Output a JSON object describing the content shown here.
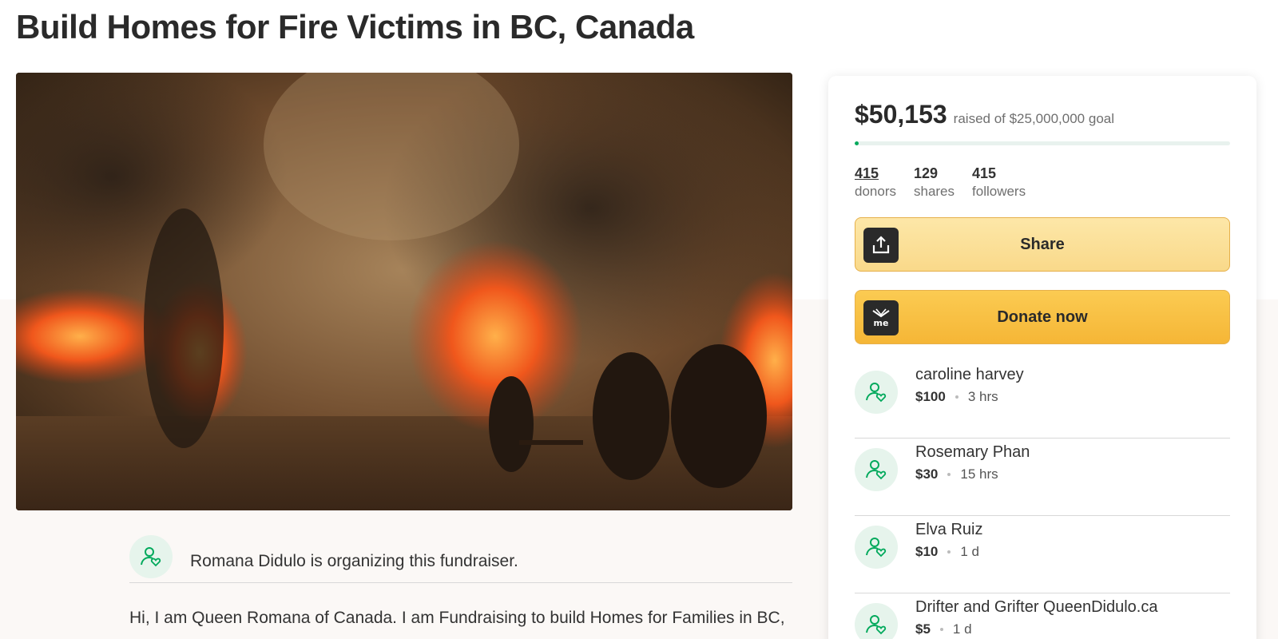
{
  "page": {
    "title": "Build Homes for Fire Victims in BC, Canada"
  },
  "organizer": {
    "text": "Romana Didulo is organizing this fundraiser.",
    "icon": "user-heart-icon"
  },
  "story": {
    "first_line": "Hi, I am Queen Romana of Canada. I am Fundraising to build Homes for Families in BC,"
  },
  "sidebar": {
    "amount_raised": "$50,153",
    "goal_text": "raised of $25,000,000 goal",
    "progress_fraction": 0.002,
    "stats": [
      {
        "value": "415",
        "label": "donors"
      },
      {
        "value": "129",
        "label": "shares"
      },
      {
        "value": "415",
        "label": "followers"
      }
    ],
    "share_label": "Share",
    "share_icon": "upload-share-icon",
    "donate_label": "Donate now",
    "donate_icon": "gofundme-logo-icon",
    "donations": [
      {
        "name": "caroline harvey",
        "amount": "$100",
        "time": "3 hrs"
      },
      {
        "name": "Rosemary Phan",
        "amount": "$30",
        "time": "15 hrs"
      },
      {
        "name": "Elva Ruiz",
        "amount": "$10",
        "time": "1 d"
      },
      {
        "name": "Drifter and Grifter QueenDidulo.ca",
        "amount": "$5",
        "time": "1 d"
      }
    ]
  },
  "colors": {
    "brand_green": "#02a95c",
    "button_yellow": "#f5b636",
    "avatar_bg": "#e6f4ec"
  }
}
